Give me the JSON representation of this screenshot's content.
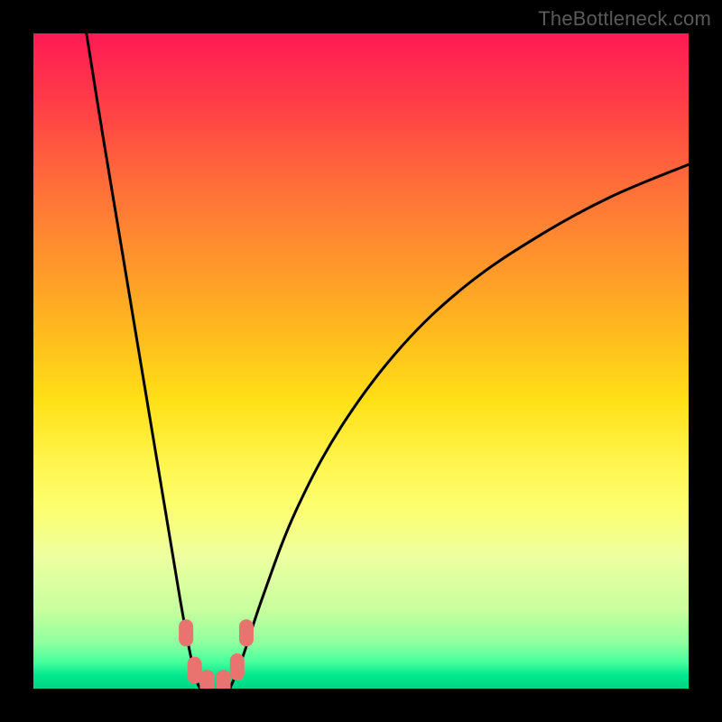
{
  "watermark": "TheBottleneck.com",
  "chart_data": {
    "type": "line",
    "title": "",
    "xlabel": "",
    "ylabel": "",
    "xlim": [
      0,
      100
    ],
    "ylim": [
      0,
      100
    ],
    "gradient_stops": [
      {
        "pos": 0.0,
        "color": "#ff1a55"
      },
      {
        "pos": 0.1,
        "color": "#ff3b48"
      },
      {
        "pos": 0.22,
        "color": "#ff6a3a"
      },
      {
        "pos": 0.33,
        "color": "#ff8f2e"
      },
      {
        "pos": 0.45,
        "color": "#ffb81f"
      },
      {
        "pos": 0.56,
        "color": "#ffe016"
      },
      {
        "pos": 0.66,
        "color": "#fff651"
      },
      {
        "pos": 0.73,
        "color": "#fbff73"
      },
      {
        "pos": 0.8,
        "color": "#edffa0"
      },
      {
        "pos": 0.88,
        "color": "#c8ff9e"
      },
      {
        "pos": 0.93,
        "color": "#8fffa0"
      },
      {
        "pos": 0.96,
        "color": "#46ff9d"
      },
      {
        "pos": 0.98,
        "color": "#00e88e"
      },
      {
        "pos": 1.0,
        "color": "#00d487"
      }
    ],
    "series": [
      {
        "name": "left-branch",
        "x": [
          8.1,
          10.5,
          13.0,
          15.5,
          18.0,
          20.5,
          22.5,
          24.0,
          25.0,
          25.5
        ],
        "y": [
          100.0,
          85.0,
          70.0,
          55.0,
          40.0,
          25.0,
          13.0,
          5.0,
          1.0,
          0.0
        ]
      },
      {
        "name": "right-branch",
        "x": [
          30.0,
          32.0,
          35.0,
          40.0,
          47.0,
          56.0,
          66.0,
          77.0,
          88.0,
          100.0
        ],
        "y": [
          0.0,
          5.0,
          14.0,
          27.0,
          40.0,
          52.0,
          61.5,
          69.0,
          75.0,
          80.0
        ]
      }
    ],
    "markers": {
      "name": "marker-dots",
      "color": "#e8736f",
      "points": [
        {
          "x": 23.3,
          "y": 8.5
        },
        {
          "x": 24.6,
          "y": 2.8
        },
        {
          "x": 26.5,
          "y": 0.8
        },
        {
          "x": 29.0,
          "y": 0.8
        },
        {
          "x": 31.1,
          "y": 3.3
        },
        {
          "x": 32.5,
          "y": 8.5
        }
      ]
    }
  }
}
